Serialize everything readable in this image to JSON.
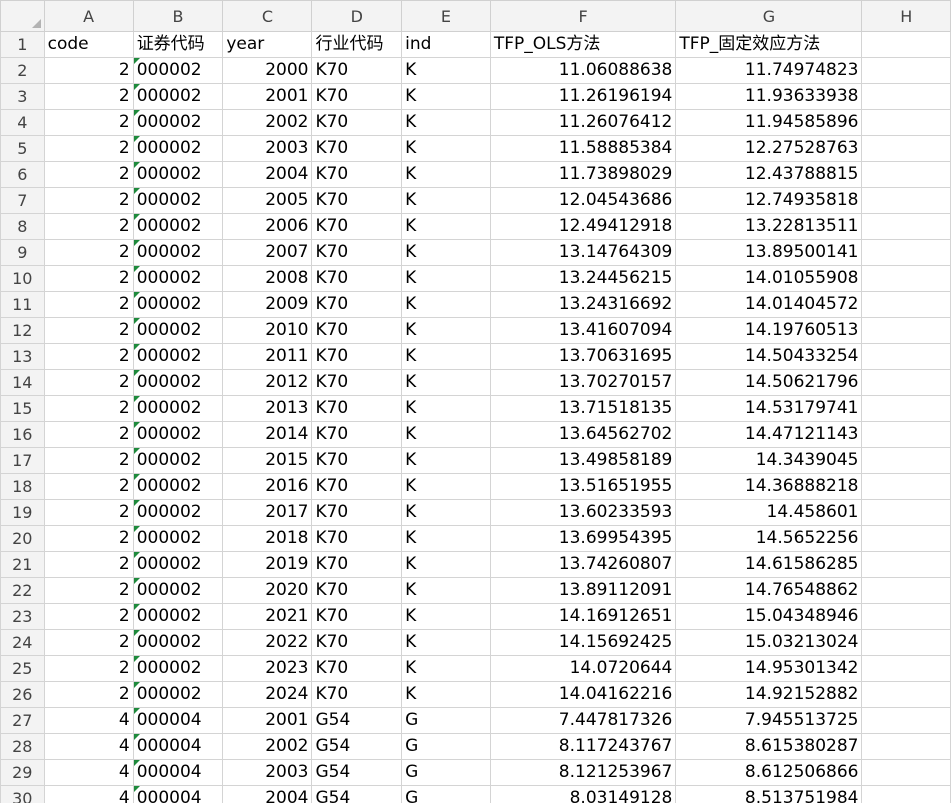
{
  "spreadsheet": {
    "columns": [
      "A",
      "B",
      "C",
      "D",
      "E",
      "F",
      "G",
      "H"
    ],
    "header_row": {
      "row_number": "1",
      "cells": [
        "code",
        "证券代码",
        "year",
        "行业代码",
        "ind",
        "TFP_OLS方法",
        "TFP_固定效应方法",
        ""
      ]
    },
    "rows": [
      {
        "n": "2",
        "code": "2",
        "sec": "000002",
        "year": "2000",
        "indcode": "K70",
        "ind": "K",
        "ols": "11.06088638",
        "fe": "11.74974823"
      },
      {
        "n": "3",
        "code": "2",
        "sec": "000002",
        "year": "2001",
        "indcode": "K70",
        "ind": "K",
        "ols": "11.26196194",
        "fe": "11.93633938"
      },
      {
        "n": "4",
        "code": "2",
        "sec": "000002",
        "year": "2002",
        "indcode": "K70",
        "ind": "K",
        "ols": "11.26076412",
        "fe": "11.94585896"
      },
      {
        "n": "5",
        "code": "2",
        "sec": "000002",
        "year": "2003",
        "indcode": "K70",
        "ind": "K",
        "ols": "11.58885384",
        "fe": "12.27528763"
      },
      {
        "n": "6",
        "code": "2",
        "sec": "000002",
        "year": "2004",
        "indcode": "K70",
        "ind": "K",
        "ols": "11.73898029",
        "fe": "12.43788815"
      },
      {
        "n": "7",
        "code": "2",
        "sec": "000002",
        "year": "2005",
        "indcode": "K70",
        "ind": "K",
        "ols": "12.04543686",
        "fe": "12.74935818"
      },
      {
        "n": "8",
        "code": "2",
        "sec": "000002",
        "year": "2006",
        "indcode": "K70",
        "ind": "K",
        "ols": "12.49412918",
        "fe": "13.22813511"
      },
      {
        "n": "9",
        "code": "2",
        "sec": "000002",
        "year": "2007",
        "indcode": "K70",
        "ind": "K",
        "ols": "13.14764309",
        "fe": "13.89500141"
      },
      {
        "n": "10",
        "code": "2",
        "sec": "000002",
        "year": "2008",
        "indcode": "K70",
        "ind": "K",
        "ols": "13.24456215",
        "fe": "14.01055908"
      },
      {
        "n": "11",
        "code": "2",
        "sec": "000002",
        "year": "2009",
        "indcode": "K70",
        "ind": "K",
        "ols": "13.24316692",
        "fe": "14.01404572"
      },
      {
        "n": "12",
        "code": "2",
        "sec": "000002",
        "year": "2010",
        "indcode": "K70",
        "ind": "K",
        "ols": "13.41607094",
        "fe": "14.19760513"
      },
      {
        "n": "13",
        "code": "2",
        "sec": "000002",
        "year": "2011",
        "indcode": "K70",
        "ind": "K",
        "ols": "13.70631695",
        "fe": "14.50433254"
      },
      {
        "n": "14",
        "code": "2",
        "sec": "000002",
        "year": "2012",
        "indcode": "K70",
        "ind": "K",
        "ols": "13.70270157",
        "fe": "14.50621796"
      },
      {
        "n": "15",
        "code": "2",
        "sec": "000002",
        "year": "2013",
        "indcode": "K70",
        "ind": "K",
        "ols": "13.71518135",
        "fe": "14.53179741"
      },
      {
        "n": "16",
        "code": "2",
        "sec": "000002",
        "year": "2014",
        "indcode": "K70",
        "ind": "K",
        "ols": "13.64562702",
        "fe": "14.47121143"
      },
      {
        "n": "17",
        "code": "2",
        "sec": "000002",
        "year": "2015",
        "indcode": "K70",
        "ind": "K",
        "ols": "13.49858189",
        "fe": "14.3439045"
      },
      {
        "n": "18",
        "code": "2",
        "sec": "000002",
        "year": "2016",
        "indcode": "K70",
        "ind": "K",
        "ols": "13.51651955",
        "fe": "14.36888218"
      },
      {
        "n": "19",
        "code": "2",
        "sec": "000002",
        "year": "2017",
        "indcode": "K70",
        "ind": "K",
        "ols": "13.60233593",
        "fe": "14.458601"
      },
      {
        "n": "20",
        "code": "2",
        "sec": "000002",
        "year": "2018",
        "indcode": "K70",
        "ind": "K",
        "ols": "13.69954395",
        "fe": "14.5652256"
      },
      {
        "n": "21",
        "code": "2",
        "sec": "000002",
        "year": "2019",
        "indcode": "K70",
        "ind": "K",
        "ols": "13.74260807",
        "fe": "14.61586285"
      },
      {
        "n": "22",
        "code": "2",
        "sec": "000002",
        "year": "2020",
        "indcode": "K70",
        "ind": "K",
        "ols": "13.89112091",
        "fe": "14.76548862"
      },
      {
        "n": "23",
        "code": "2",
        "sec": "000002",
        "year": "2021",
        "indcode": "K70",
        "ind": "K",
        "ols": "14.16912651",
        "fe": "15.04348946"
      },
      {
        "n": "24",
        "code": "2",
        "sec": "000002",
        "year": "2022",
        "indcode": "K70",
        "ind": "K",
        "ols": "14.15692425",
        "fe": "15.03213024"
      },
      {
        "n": "25",
        "code": "2",
        "sec": "000002",
        "year": "2023",
        "indcode": "K70",
        "ind": "K",
        "ols": "14.0720644",
        "fe": "14.95301342"
      },
      {
        "n": "26",
        "code": "2",
        "sec": "000002",
        "year": "2024",
        "indcode": "K70",
        "ind": "K",
        "ols": "14.04162216",
        "fe": "14.92152882"
      },
      {
        "n": "27",
        "code": "4",
        "sec": "000004",
        "year": "2001",
        "indcode": "G54",
        "ind": "G",
        "ols": "7.447817326",
        "fe": "7.945513725"
      },
      {
        "n": "28",
        "code": "4",
        "sec": "000004",
        "year": "2002",
        "indcode": "G54",
        "ind": "G",
        "ols": "8.117243767",
        "fe": "8.615380287"
      },
      {
        "n": "29",
        "code": "4",
        "sec": "000004",
        "year": "2003",
        "indcode": "G54",
        "ind": "G",
        "ols": "8.121253967",
        "fe": "8.612506866"
      },
      {
        "n": "30",
        "code": "4",
        "sec": "000004",
        "year": "2004",
        "indcode": "G54",
        "ind": "G",
        "ols": "8.03149128",
        "fe": "8.513751984"
      }
    ]
  }
}
